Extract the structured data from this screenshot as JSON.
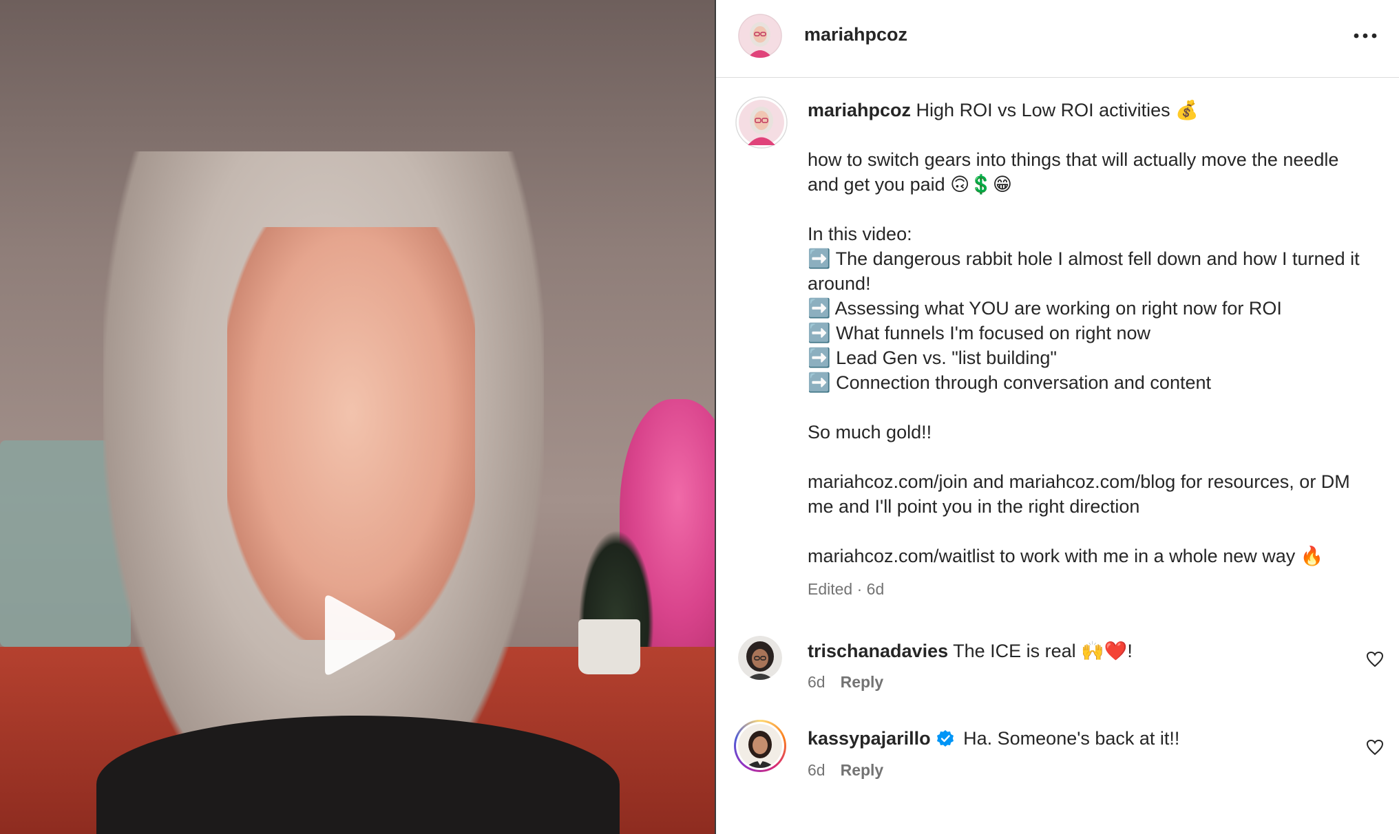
{
  "video": {
    "play_icon": "play-icon"
  },
  "header": {
    "username": "mariahpcoz",
    "more_icon": "more-horizontal-icon"
  },
  "post": {
    "username": "mariahpcoz",
    "caption_body": " High ROI vs Low ROI activities 💰\n\nhow to switch gears into things that will actually move the needle and get you paid 🙃💲😁\n\nIn this video:\n➡️ The dangerous rabbit hole I almost fell down and how I turned it around!\n➡️ Assessing what YOU are working on right now for ROI\n➡️ What funnels I'm focused on right now\n➡️ Lead Gen vs. \"list building\"\n➡️ Connection through conversation and content\n\nSo much gold!!\n\nmariahcoz.com/join and mariahcoz.com/blog for resources, or DM me and I'll point you in the right direction\n\nmariahcoz.com/waitlist to work with me in a whole new way 🔥",
    "meta": "Edited · 6d"
  },
  "comments": [
    {
      "username": "trischanadavies",
      "text": " The ICE is real 🙌❤️!",
      "time": "6d",
      "reply_label": "Reply",
      "verified": false
    },
    {
      "username": "kassypajarillo",
      "text": " Ha. Someone's back at it!!",
      "time": "6d",
      "reply_label": "Reply",
      "verified": true
    }
  ],
  "colors": {
    "text": "#262626",
    "muted": "#737373",
    "verified": "#0095f6",
    "divider": "#dbdbdb"
  }
}
